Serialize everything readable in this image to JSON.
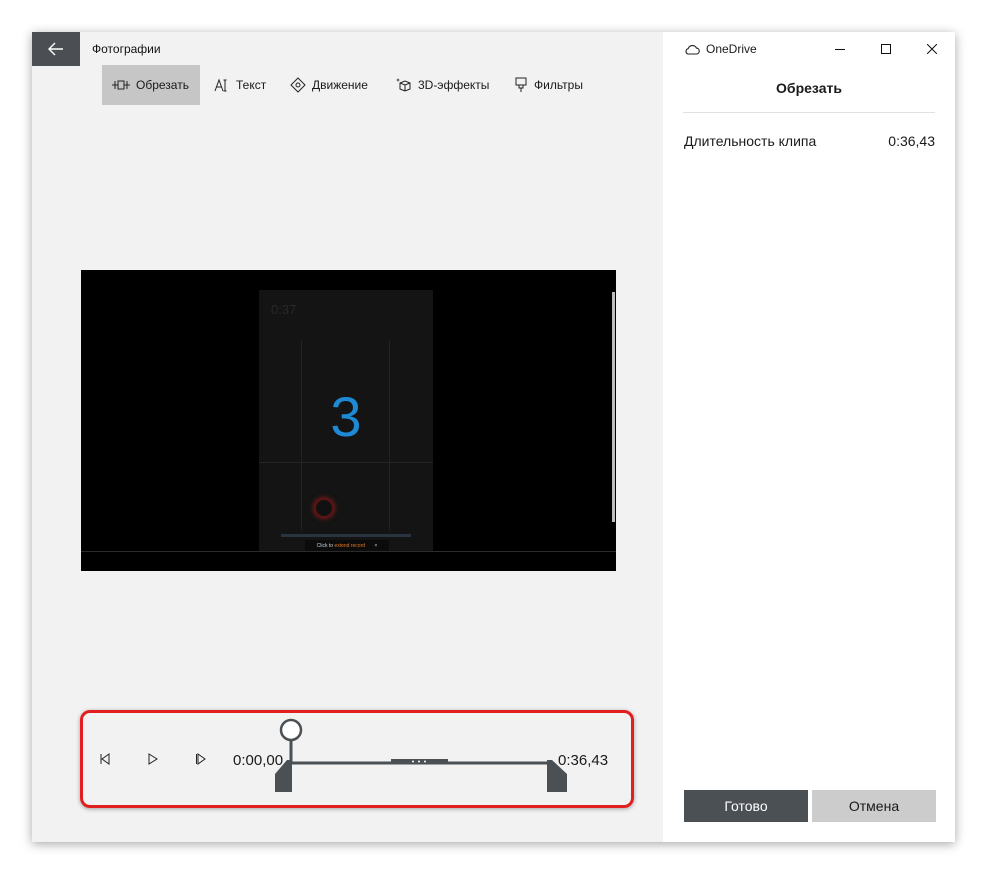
{
  "window": {
    "app_title": "Фотографии",
    "onedrive_label": "OneDrive"
  },
  "toolbar": {
    "items": [
      {
        "label": "Обрезать",
        "icon": "trim-icon",
        "active": true
      },
      {
        "label": "Текст",
        "icon": "text-icon",
        "active": false
      },
      {
        "label": "Движение",
        "icon": "motion-icon",
        "active": false
      },
      {
        "label": "3D-эффекты",
        "icon": "3d-effects-icon",
        "active": false
      },
      {
        "label": "Фильтры",
        "icon": "filters-icon",
        "active": false
      }
    ]
  },
  "video": {
    "countdown": "3",
    "corner_time": "0:37",
    "toast_text": "Click to ",
    "toast_accent": "extend record"
  },
  "timeline": {
    "start_time": "0:00,00",
    "end_time": "0:36,43",
    "controls": [
      "previous-frame-icon",
      "play-icon",
      "next-frame-icon"
    ]
  },
  "panel": {
    "title": "Обрезать",
    "clip_duration_label": "Длительность клипа",
    "clip_duration_value": "0:36,43",
    "done_label": "Готово",
    "cancel_label": "Отмена"
  },
  "colors": {
    "accent_highlight": "#e11f1f",
    "countdown_blue": "#1e8ad6",
    "dark_button": "#4b5055",
    "light_button": "#cccccc"
  }
}
